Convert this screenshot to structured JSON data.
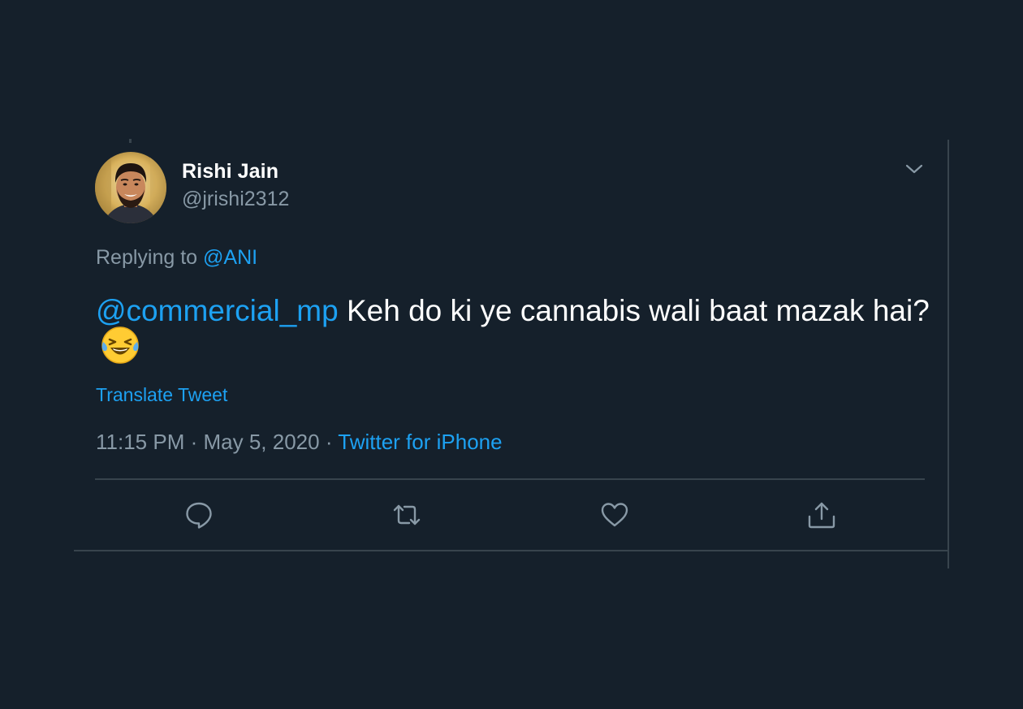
{
  "tweet": {
    "author": {
      "display_name": "Rishi Jain",
      "handle": "@jrishi2312",
      "avatar": "avatar-photo"
    },
    "menu_icon": "chevron-down-icon",
    "replying_prefix": "Replying to",
    "replying_to": "@ANI",
    "text_mention": "@commercial_mp",
    "text_body": " Keh do ki ye cannabis wali baat mazak hai?",
    "emoji": "face-with-tears-of-joy",
    "translate_label": "Translate Tweet",
    "time": "11:15 PM",
    "separator": "·",
    "date": "May 5, 2020",
    "source": "Twitter for iPhone"
  },
  "actions": [
    {
      "name": "reply",
      "icon": "comment-bubble-icon"
    },
    {
      "name": "retweet",
      "icon": "retweet-icon"
    },
    {
      "name": "like",
      "icon": "heart-icon"
    },
    {
      "name": "share",
      "icon": "share-upload-icon"
    }
  ],
  "colors": {
    "background": "#15202b",
    "border": "#38444d",
    "primary_text": "#ffffff",
    "secondary_text": "#8899a6",
    "accent": "#1da1f2"
  }
}
